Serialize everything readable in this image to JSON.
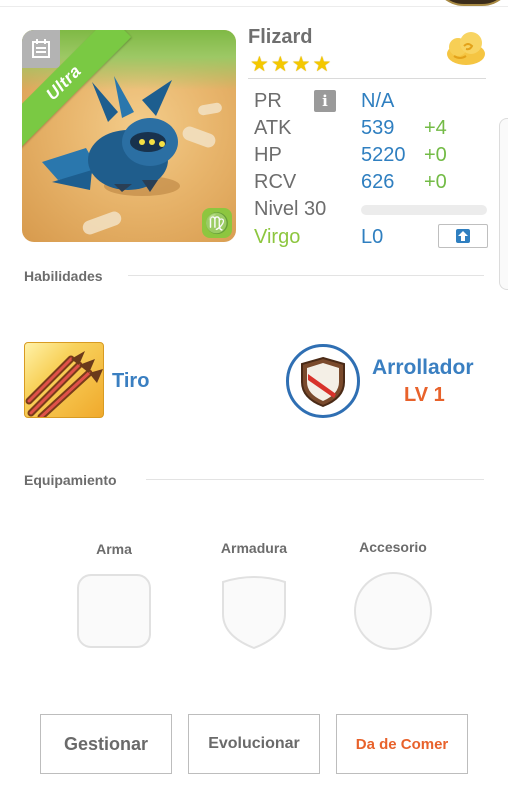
{
  "monster": {
    "name": "Flizard",
    "rarity_label": "Ultra",
    "stars": 4,
    "zodiac_symbol": "♍"
  },
  "stats": {
    "pr": {
      "label": "PR",
      "value": "N/A",
      "info_icon": "i"
    },
    "atk": {
      "label": "ATK",
      "value": "539",
      "bonus": "+4"
    },
    "hp": {
      "label": "HP",
      "value": "5220",
      "bonus": "+0"
    },
    "rcv": {
      "label": "RCV",
      "value": "626",
      "bonus": "+0"
    },
    "level": {
      "label": "Nivel 30",
      "progress": 0.0
    },
    "sign": {
      "label": "Virgo",
      "value": "L0"
    }
  },
  "skills": {
    "title": "Habilidades",
    "skill_1": {
      "name": "Tiro",
      "icon": "triple-arrow-icon"
    },
    "skill_2": {
      "name": "Arrollador",
      "level": "LV 1",
      "icon": "shield-badge-icon"
    }
  },
  "equipment": {
    "title": "Equipamiento",
    "weapon": "Arma",
    "armor": "Armadura",
    "accessory": "Accesorio"
  },
  "actions": {
    "manage": "Gestionar",
    "evolve": "Evolucionar",
    "feed": "Da de Comer"
  },
  "colors": {
    "accent_blue": "#2f7fc0",
    "bonus_green": "#73bb46",
    "ultra_green": "#7ac943",
    "feed_orange": "#e8622b",
    "star_gold": "#f4c800"
  }
}
